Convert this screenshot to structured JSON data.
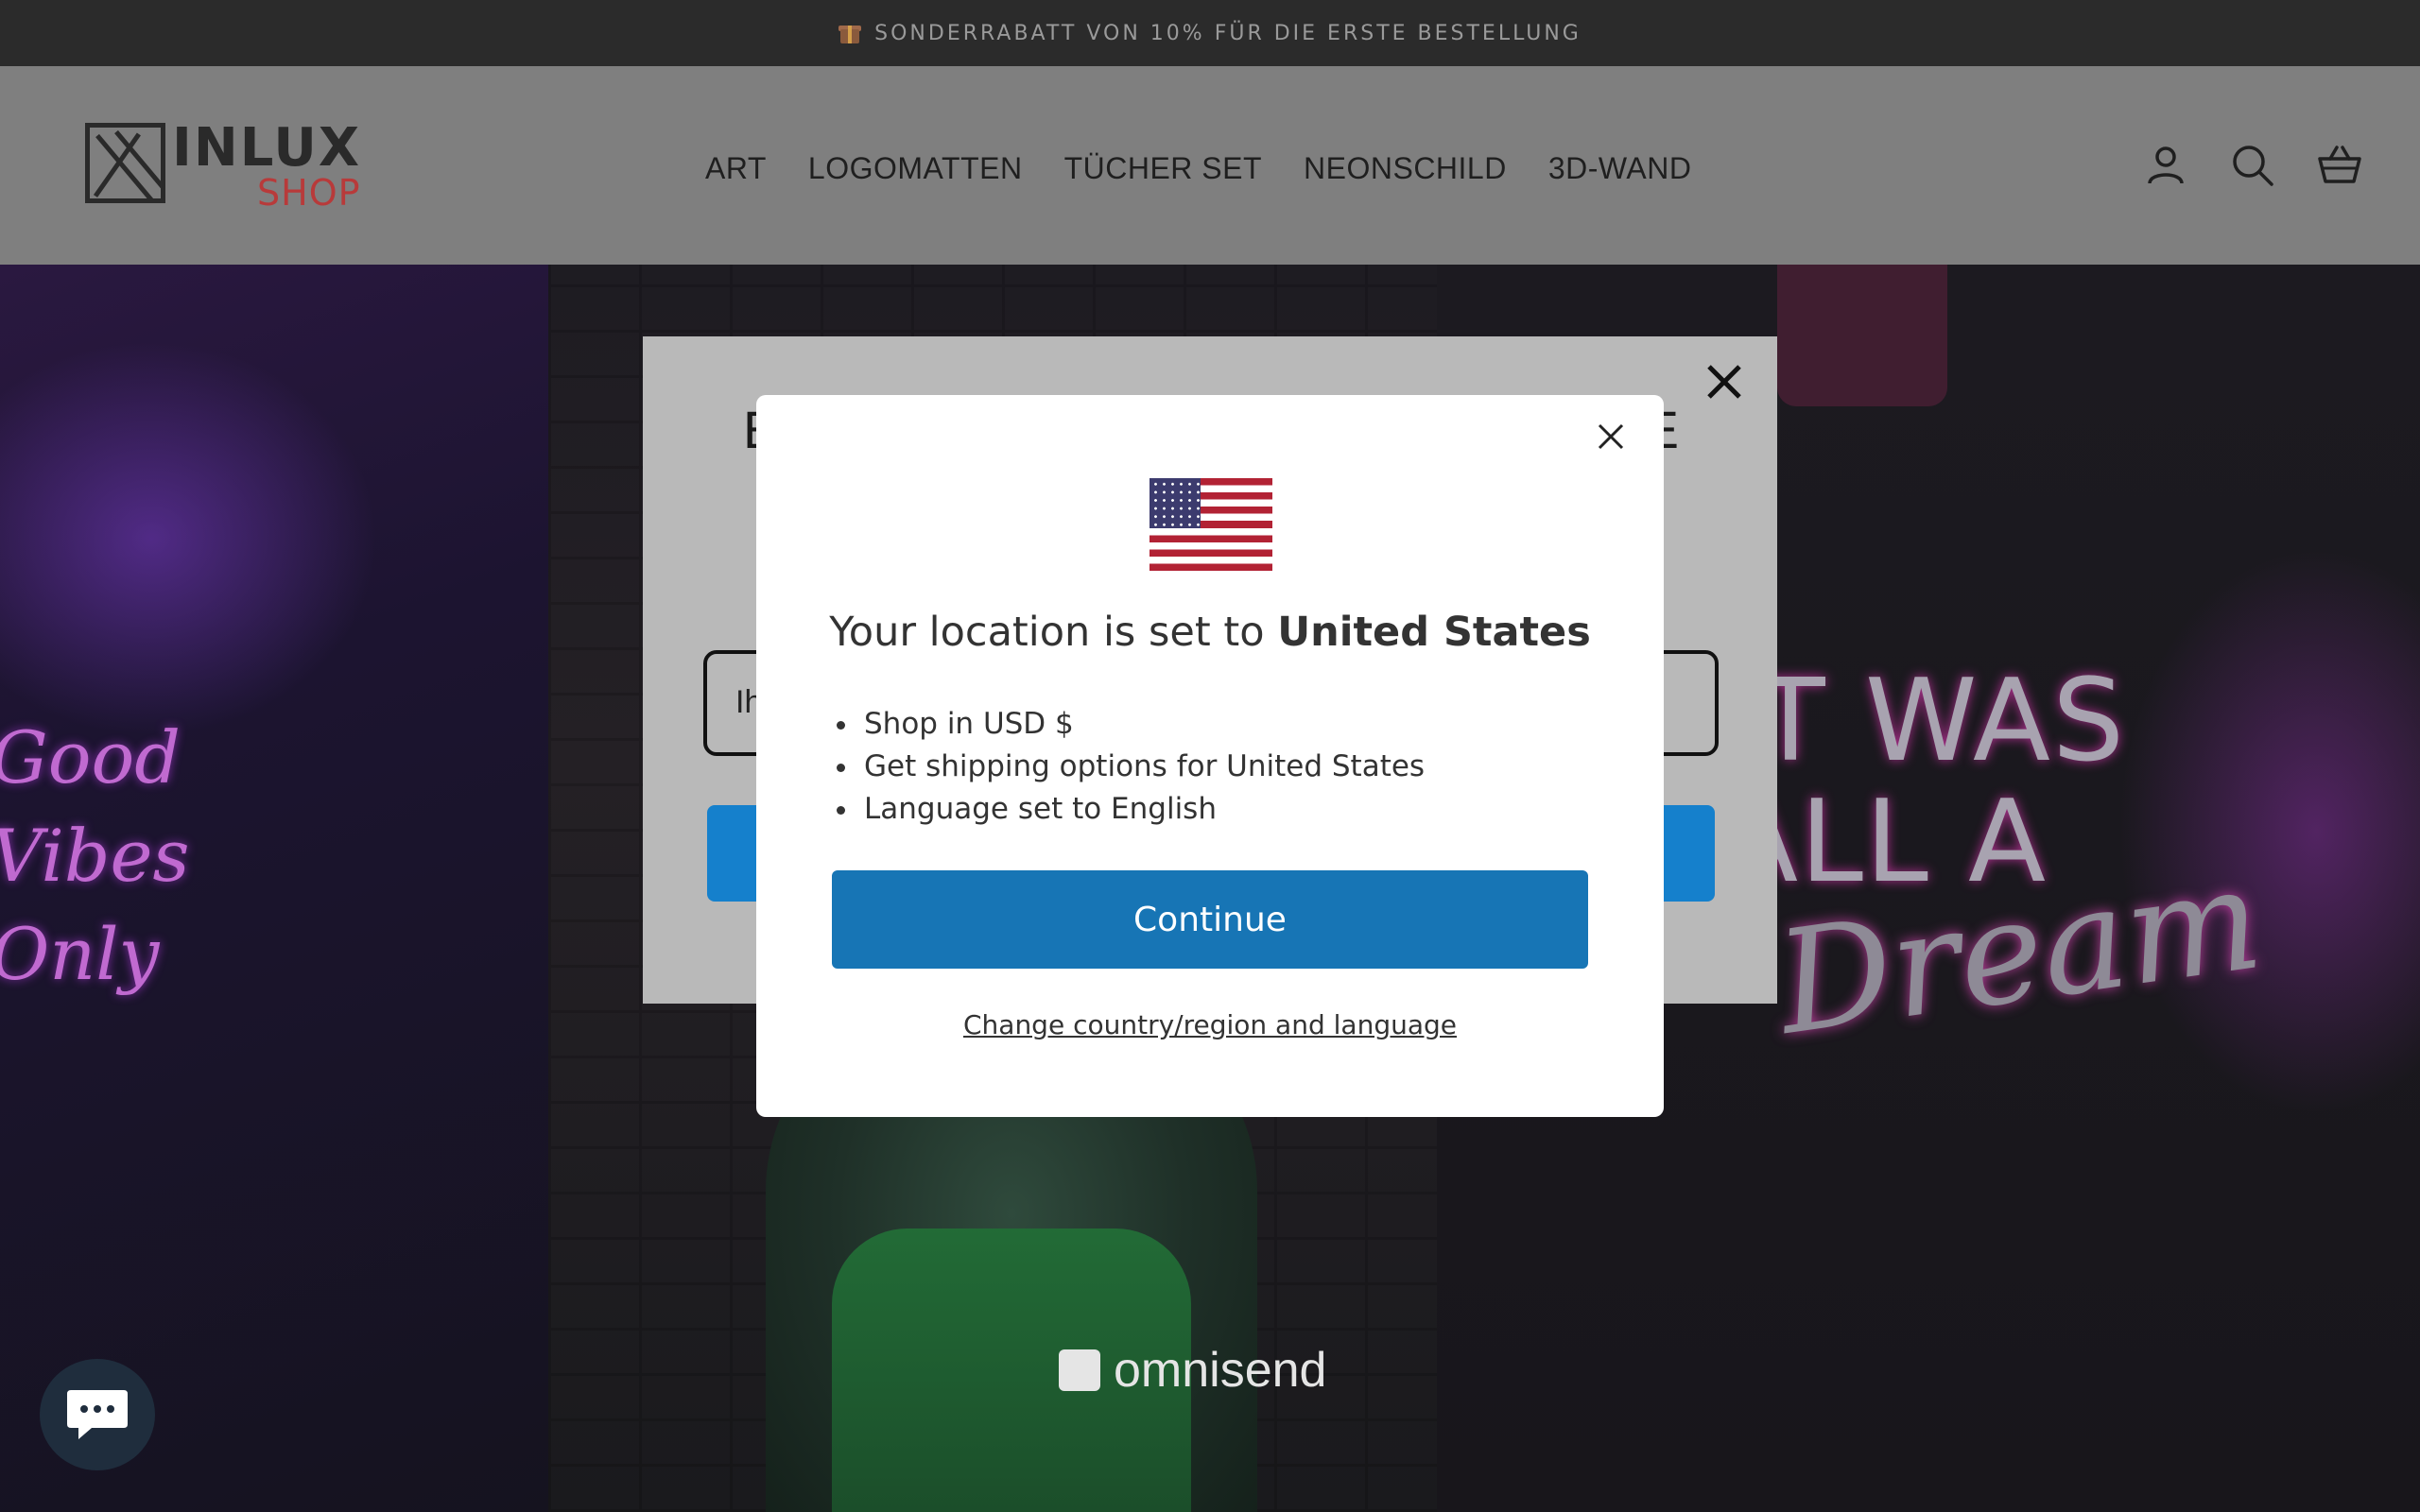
{
  "announcement": {
    "icon": "gift-icon",
    "text": "SONDERRABATT VON 10% FÜR DIE ERSTE BESTELLUNG"
  },
  "header": {
    "logo": {
      "word1": "INLUX",
      "word2": "SHOP"
    },
    "nav": [
      "ART",
      "LOGOMATTEN",
      "TÜCHER SET",
      "NEONSCHILD",
      "3D-WAND"
    ],
    "icons": [
      "account-icon",
      "search-icon",
      "cart-icon"
    ]
  },
  "hero": {
    "left_sign": "Good Vibes Only",
    "right_sign_line1": "IT WAS",
    "right_sign_line2": "ALL A",
    "right_sign_script": "Dream",
    "omnisend": "omnisend"
  },
  "signup_popup": {
    "headline_left": "E",
    "headline_right": "E",
    "email_placeholder": "Ih"
  },
  "location_modal": {
    "title_prefix": "Your location is set to ",
    "title_country": "United States",
    "bullets": [
      "Shop in USD $",
      "Get shipping options for United States",
      "Language set to English"
    ],
    "continue_label": "Continue",
    "change_link": "Change country/region and language",
    "colors": {
      "primary": "#1775b5"
    }
  },
  "chat": {
    "icon": "chat-icon"
  }
}
